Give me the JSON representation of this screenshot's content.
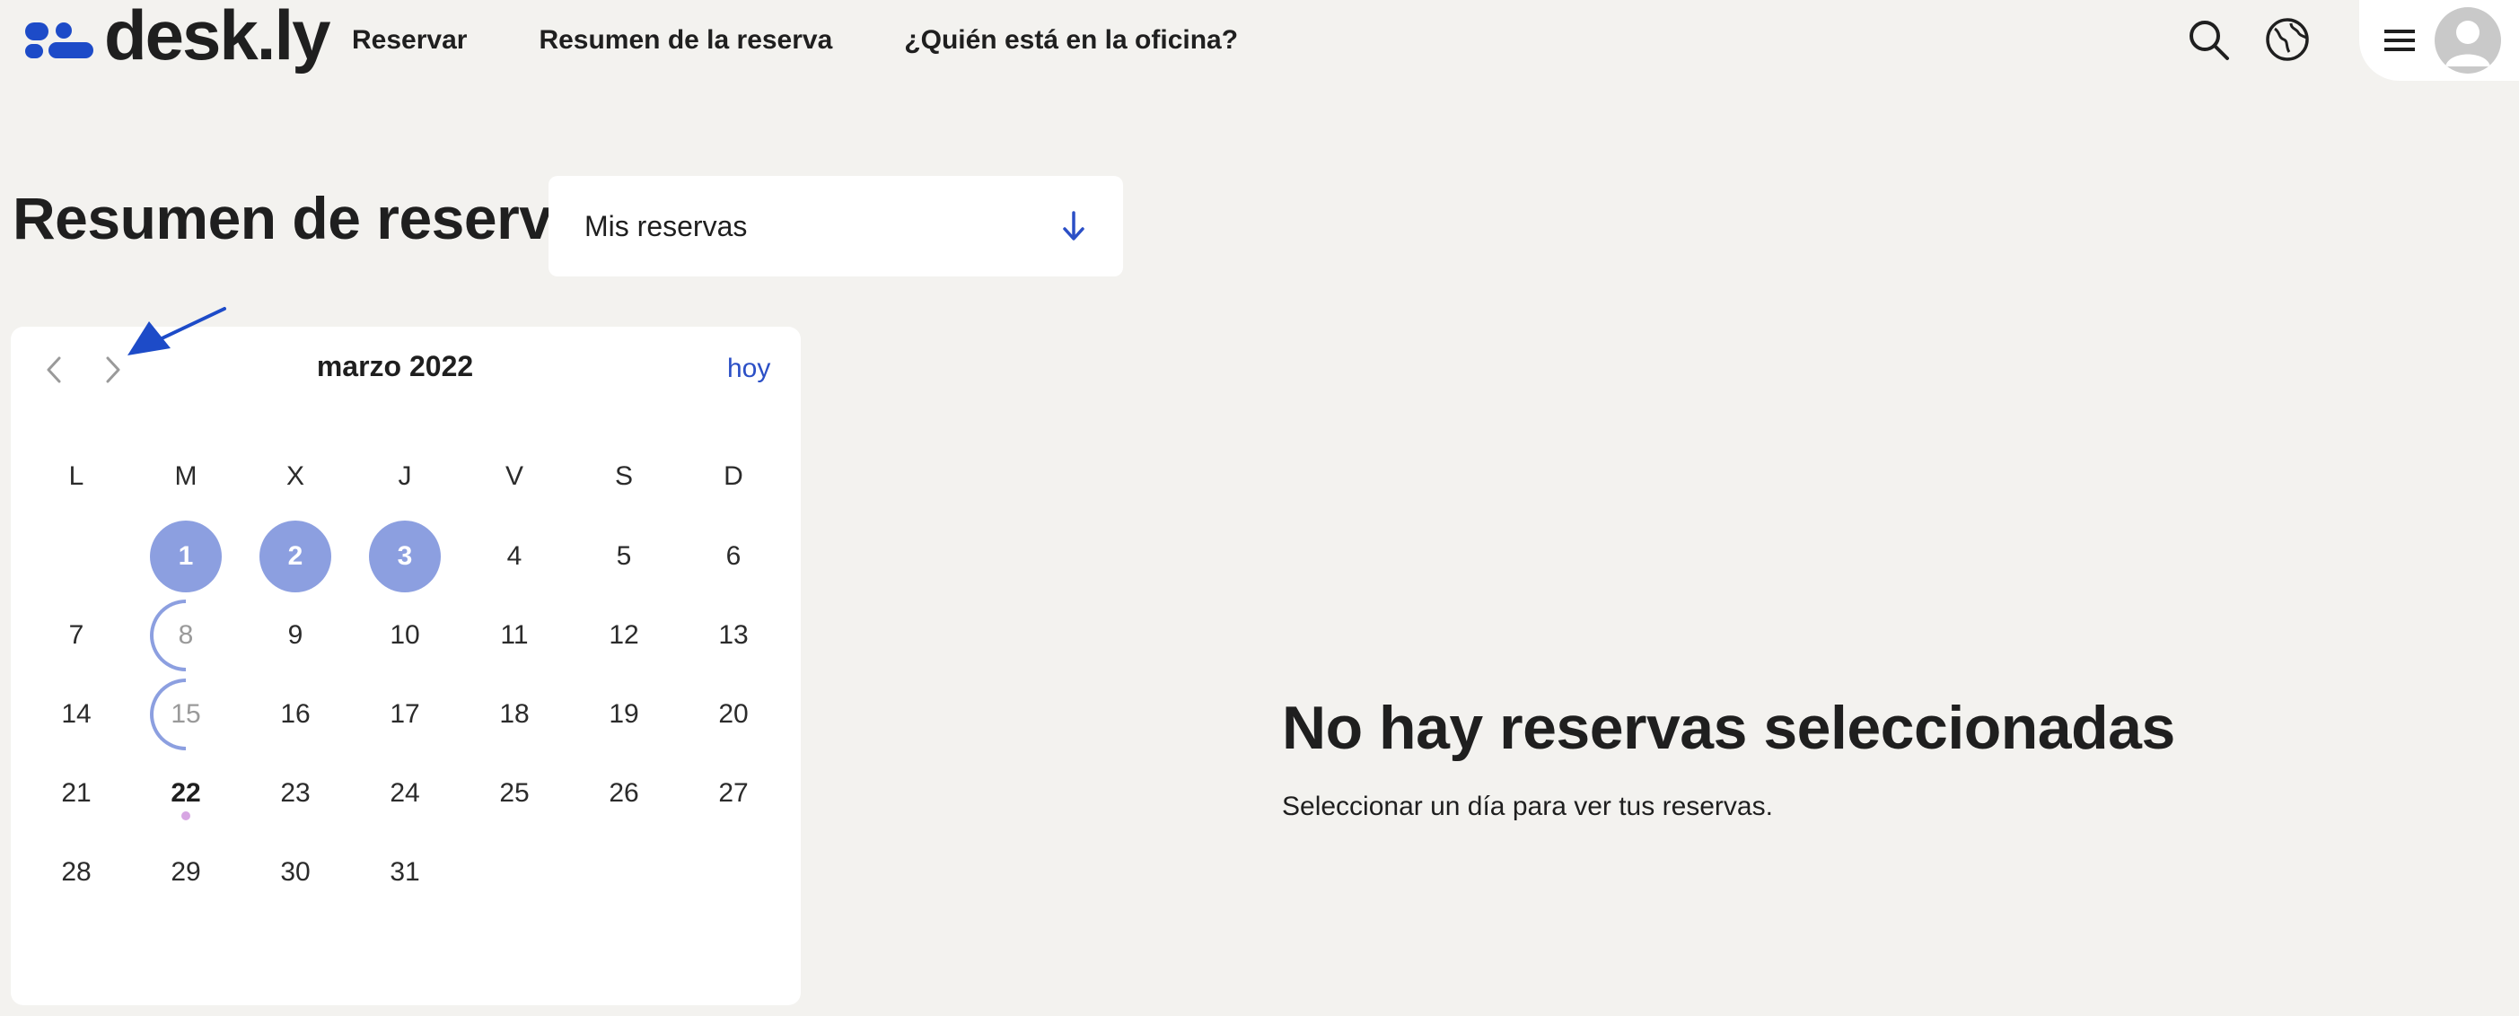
{
  "app": {
    "logo_text": "desk.ly",
    "brand_color": "#1d4bc8"
  },
  "nav": {
    "items": [
      "Reservar",
      "Resumen de la reserva",
      "¿Quién está en la oficina?"
    ]
  },
  "header_icons": [
    "search-icon",
    "globe-icon",
    "menu-icon",
    "avatar-icon"
  ],
  "page": {
    "title": "Resumen de reserva",
    "filter": {
      "selected": "Mis reservas"
    }
  },
  "calendar": {
    "month_label": "marzo 2022",
    "today_label": "hoy",
    "weekdays": [
      "L",
      "M",
      "X",
      "J",
      "V",
      "S",
      "D"
    ],
    "days": {
      "d1": "1",
      "d2": "2",
      "d3": "3",
      "d4": "4",
      "d5": "5",
      "d6": "6",
      "d7": "7",
      "d8": "8",
      "d9": "9",
      "d10": "10",
      "d11": "11",
      "d12": "12",
      "d13": "13",
      "d14": "14",
      "d15": "15",
      "d16": "16",
      "d17": "17",
      "d18": "18",
      "d19": "19",
      "d20": "20",
      "d21": "21",
      "d22": "22",
      "d23": "23",
      "d24": "24",
      "d25": "25",
      "d26": "26",
      "d27": "27",
      "d28": "28",
      "d29": "29",
      "d30": "30",
      "d31": "31"
    },
    "booked_days": [
      "1",
      "2",
      "3"
    ],
    "half_booked_days": [
      "8",
      "15"
    ],
    "current_day": "22",
    "booking_color": "#8c9fe0"
  },
  "empty_state": {
    "title": "No hay reservas seleccionadas",
    "subtitle": "Seleccionar un día para ver tus reservas."
  }
}
